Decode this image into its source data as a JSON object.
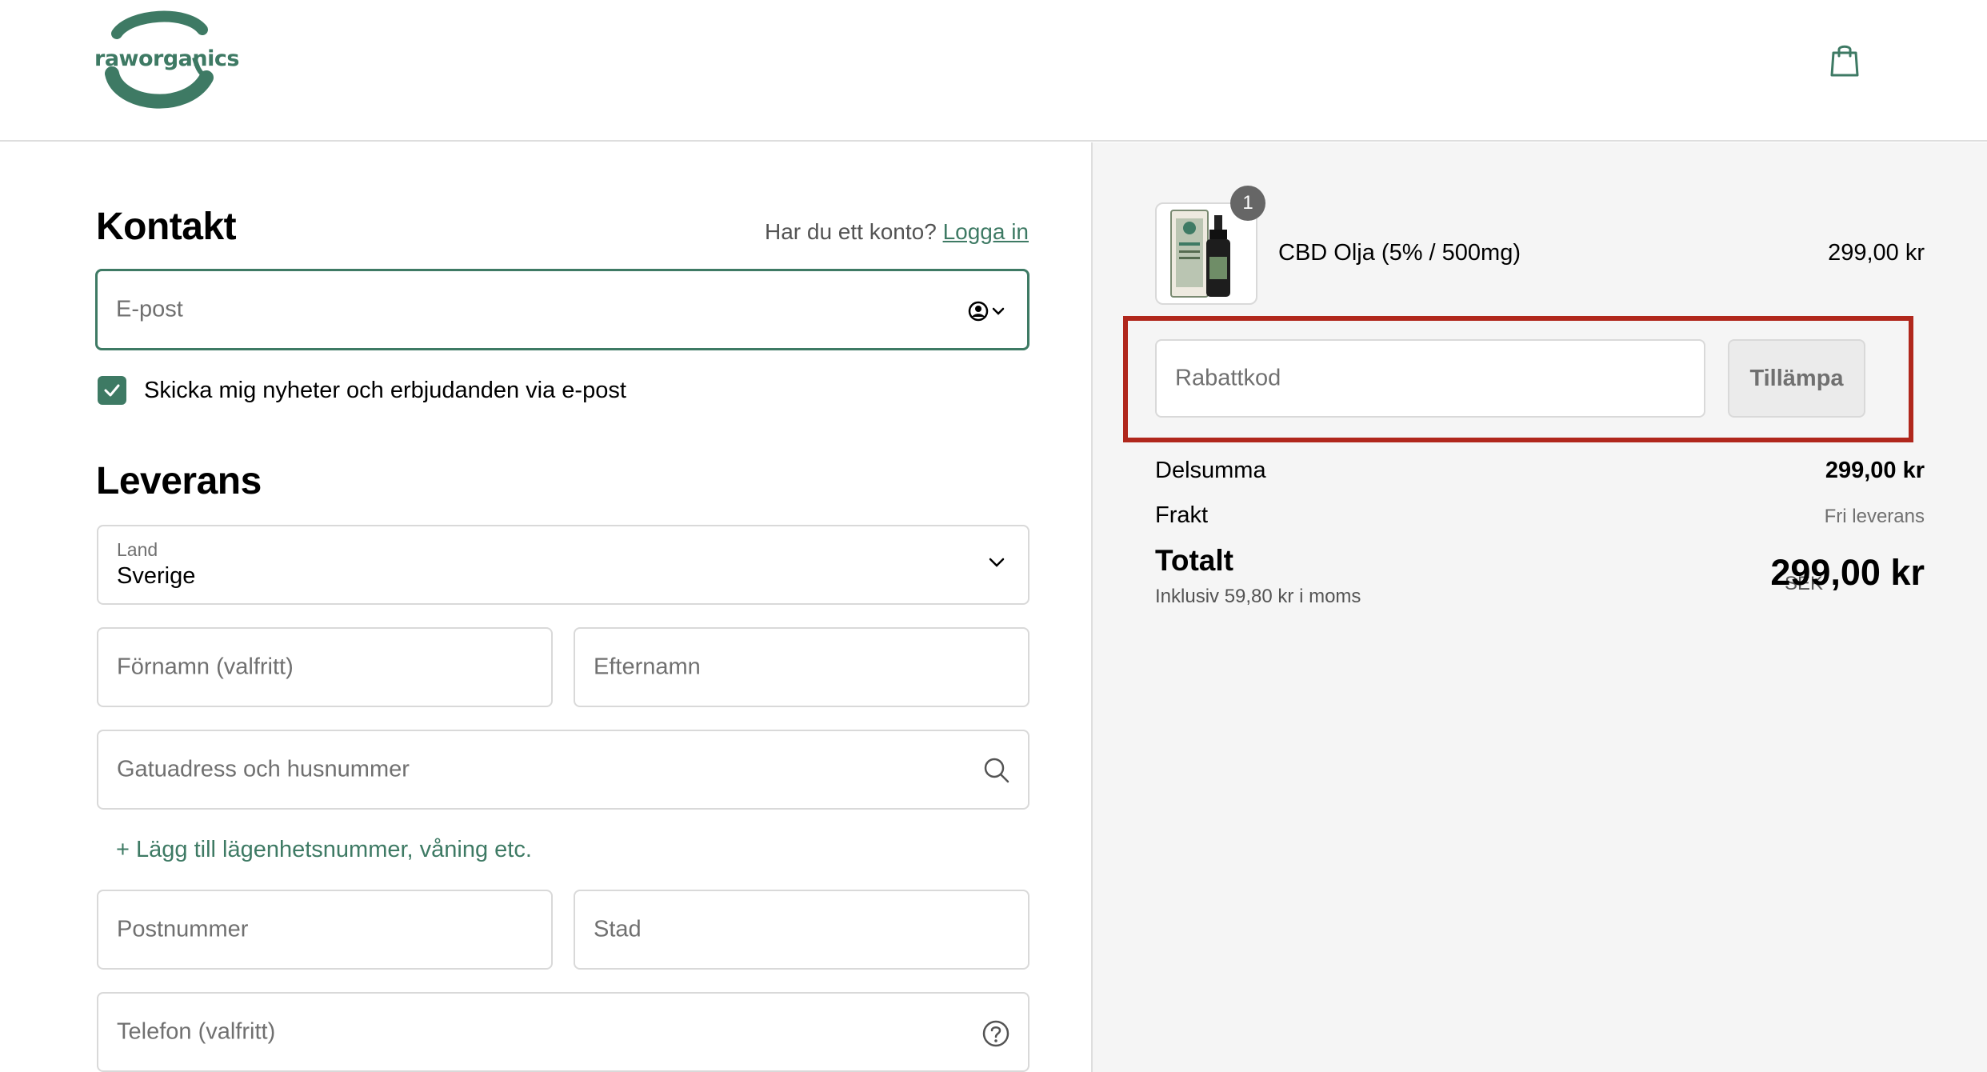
{
  "header": {
    "logo_text": "raworganics",
    "cart_icon": "shopping-bag-icon"
  },
  "contact": {
    "title": "Kontakt",
    "have_account": "Har du ett konto?",
    "login_link": "Logga in",
    "email_placeholder": "E-post",
    "newsletter_label": "Skicka mig nyheter och erbjudanden via e-post",
    "newsletter_checked": true
  },
  "delivery": {
    "title": "Leverans",
    "country_label": "Land",
    "country_value": "Sverige",
    "first_name_placeholder": "Förnamn (valfritt)",
    "last_name_placeholder": "Efternamn",
    "address_placeholder": "Gatuadress och husnummer",
    "add_apartment": "+ Lägg till lägenhetsnummer, våning etc.",
    "postal_placeholder": "Postnummer",
    "city_placeholder": "Stad",
    "phone_placeholder": "Telefon (valfritt)"
  },
  "summary": {
    "item": {
      "quantity": "1",
      "name": "CBD Olja (5% / 500mg)",
      "price": "299,00 kr"
    },
    "discount_placeholder": "Rabattkod",
    "apply_label": "Tillämpa",
    "subtotal_label": "Delsumma",
    "subtotal_value": "299,00 kr",
    "shipping_label": "Frakt",
    "shipping_value": "Fri leverans",
    "total_label": "Totalt",
    "tax_note": "Inklusiv 59,80 kr i moms",
    "currency": "SEK",
    "total_value": "299,00 kr"
  },
  "colors": {
    "brand": "#3e7a64",
    "highlight": "#b0271c"
  }
}
